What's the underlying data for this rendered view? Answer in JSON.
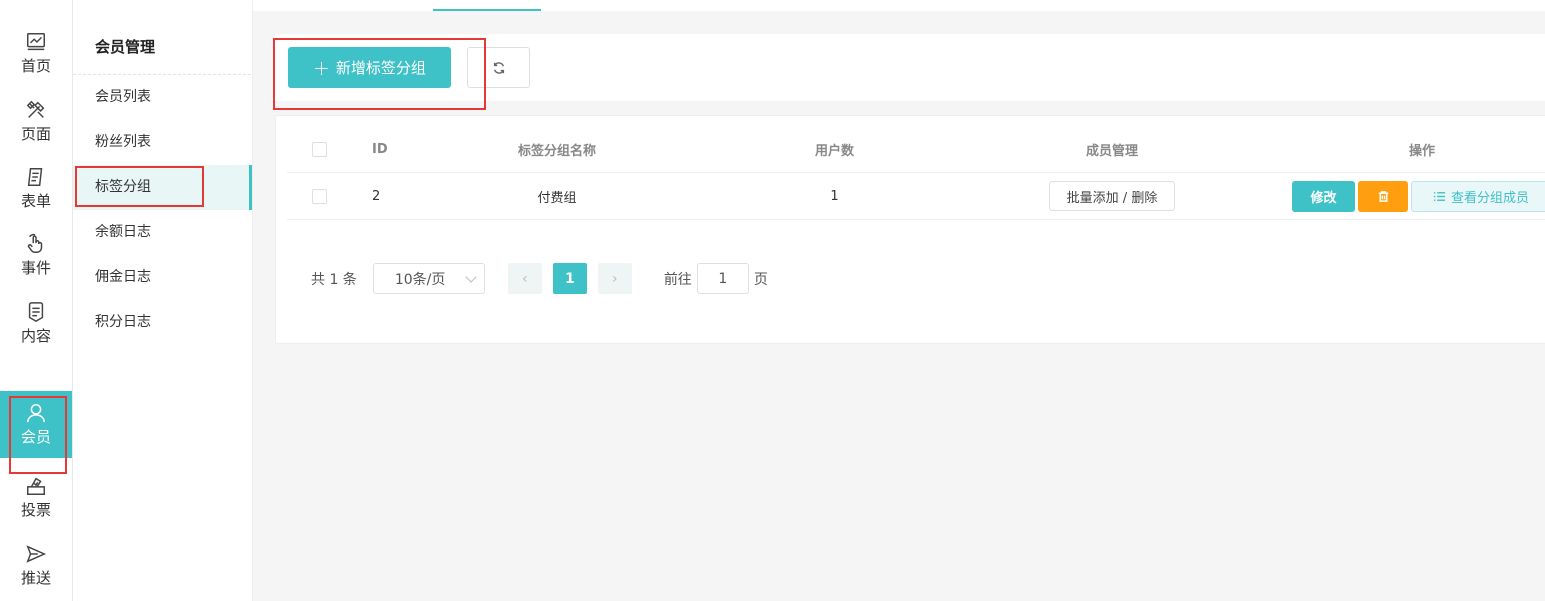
{
  "rail": {
    "items": [
      {
        "label": "首页",
        "icon": "chart-icon"
      },
      {
        "label": "页面",
        "icon": "tools-icon"
      },
      {
        "label": "表单",
        "icon": "form-icon"
      },
      {
        "label": "事件",
        "icon": "hand-pointer-icon"
      },
      {
        "label": "内容",
        "icon": "document-icon"
      },
      {
        "label": "会员",
        "icon": "user-icon",
        "active": true
      },
      {
        "label": "投票",
        "icon": "ballot-icon"
      },
      {
        "label": "推送",
        "icon": "send-icon"
      }
    ]
  },
  "submenu": {
    "title": "会员管理",
    "items": [
      {
        "label": "会员列表"
      },
      {
        "label": "粉丝列表"
      },
      {
        "label": "标签分组",
        "active": true
      },
      {
        "label": "余额日志"
      },
      {
        "label": "佣金日志"
      },
      {
        "label": "积分日志"
      }
    ]
  },
  "toolbar": {
    "add_label": "新增标签分组",
    "add_icon": "plus-icon",
    "refresh_icon": "refresh-icon"
  },
  "table": {
    "headers": {
      "id": "ID",
      "name": "标签分组名称",
      "users": "用户数",
      "manage": "成员管理",
      "ops": "操作"
    },
    "rows": [
      {
        "id": "2",
        "name": "付费组",
        "users": "1",
        "manage_label": "批量添加 / 删除",
        "edit_label": "修改",
        "delete_icon": "trash-icon",
        "view_label": "查看分组成员",
        "view_icon": "list-icon"
      }
    ]
  },
  "pager": {
    "total": "共 1 条",
    "page_size": "10条/页",
    "current_page": "1",
    "goto_label": "前往",
    "goto_value": "1",
    "page_suffix": "页"
  },
  "colors": {
    "accent": "#3ec1c7",
    "warning": "#ff9f0f",
    "annotation": "#e53935"
  }
}
